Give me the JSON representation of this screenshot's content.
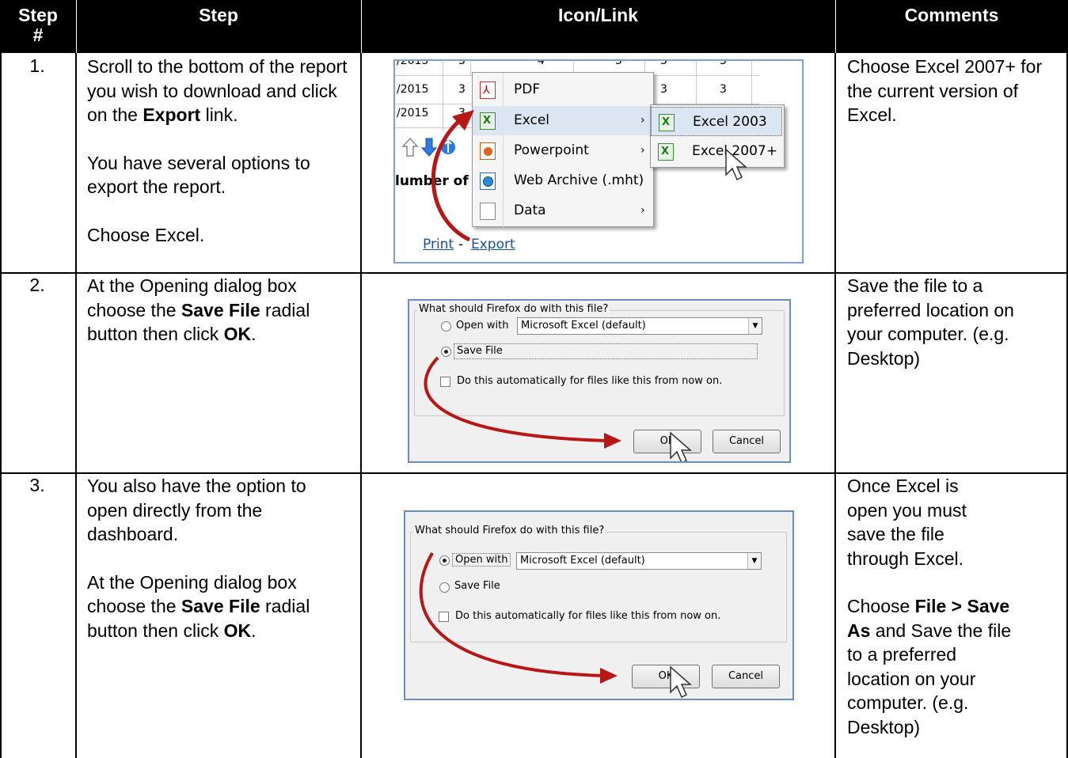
{
  "header": {
    "col1": "Step #",
    "col2": "Step",
    "col3": "Icon/Link",
    "col4": "Comments"
  },
  "rows": [
    {
      "num": "1.",
      "step_a": "Scroll to the bottom of the report you wish to download and click on the",
      "step_a_bold": "Export",
      "step_a_end": "link.",
      "step_b": "You have several options to export the report.",
      "step_c": "Choose Excel.",
      "comment": "Choose Excel 2007+ for the current version of Excel."
    },
    {
      "num": "2.",
      "step_a": "At the Opening dialog box choose the",
      "step_a_bold": "Save File",
      "step_a_end": "radial button then click",
      "step_a_bold2": "OK",
      "step_a_end2": ".",
      "comment": "Save the file to a preferred location on your computer. (e.g. Desktop)"
    },
    {
      "num": "3.",
      "step_a": "You also have the option to open directly from the dashboard.",
      "step_b": "At the Opening dialog box choose the",
      "step_b_bold": "Save File",
      "step_b_end": "radial button then click",
      "step_b_bold2": "OK",
      "step_b_end2": ".",
      "comment_a": "Once Excel is open you must save the file through Excel.",
      "comment_b": "Choose",
      "comment_b_bold": "File > Save As",
      "comment_b_end": "and Save the file to a preferred location on your computer. (e.g. Desktop)"
    }
  ],
  "shot1": {
    "rows": [
      {
        "date": "/2015",
        "v": [
          "3",
          "4",
          "5",
          "3",
          "3"
        ]
      },
      {
        "date": "/2015",
        "v": [
          "3",
          "",
          "",
          "3",
          "3"
        ]
      },
      {
        "date": "/2015",
        "v": [
          "3",
          "",
          "",
          "",
          ""
        ]
      }
    ],
    "label_partial": "lumber of",
    "menu": [
      "PDF",
      "Excel",
      "Powerpoint",
      "Web Archive (.mht)",
      "Data"
    ],
    "submenu": [
      "Excel 2003",
      "Excel 2007+"
    ],
    "link_print": "Print",
    "link_sep": "-",
    "link_export": "Export"
  },
  "dialog": {
    "group_title": "What should Firefox do with this file?",
    "open_with": "Open with",
    "app": "Microsoft Excel (default)",
    "save_file": "Save File",
    "auto": "Do this automatically for files like this from now on.",
    "ok": "OK",
    "cancel": "Cancel"
  },
  "colors": {
    "header_bg": "#000000",
    "arrow": "#c01a1a",
    "link": "#1b4f9a",
    "dialog_border": "#6a8fba"
  }
}
